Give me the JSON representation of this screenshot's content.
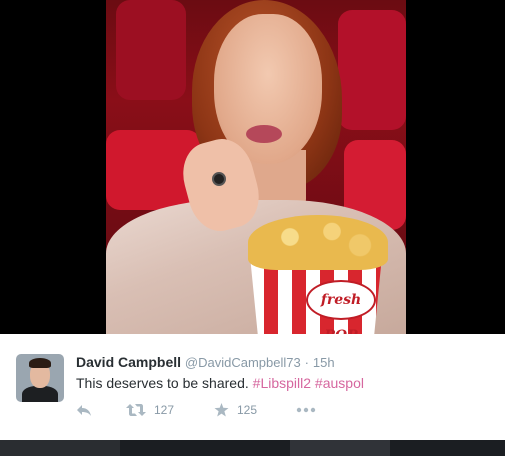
{
  "tweet": {
    "author_name": "David Campbell",
    "author_handle": "@DavidCampbell73",
    "separator": "·",
    "timestamp": "15h",
    "text_plain": "This deserves to be shared.",
    "hashtags": [
      "#Libspill2",
      "#auspol"
    ],
    "retweet_count": "127",
    "favorite_count": "125"
  },
  "media": {
    "bucket_logo_text": "fresh POP"
  },
  "icons": {
    "reply": "reply-icon",
    "retweet": "retweet-icon",
    "favorite": "star-icon",
    "more": "more-icon"
  },
  "colors": {
    "hashtag": "#d6679f",
    "muted": "#8899a6",
    "text": "#292f33",
    "action": "#aab8c2"
  }
}
